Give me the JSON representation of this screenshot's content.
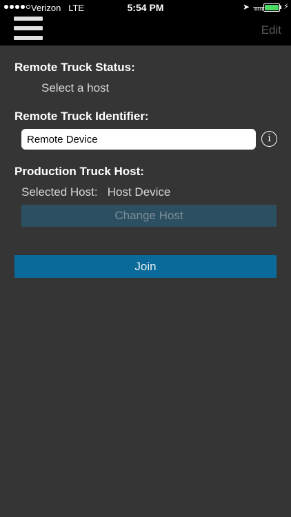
{
  "status_bar": {
    "carrier": "Verizon",
    "network": "LTE",
    "time": "5:54 PM"
  },
  "nav": {
    "menu_icon": "hamburger-menu-icon",
    "edit_label": "Edit"
  },
  "status_section": {
    "heading": "Remote Truck Status:",
    "value": "Select a host"
  },
  "identifier_section": {
    "heading": "Remote Truck Identifier:",
    "value": "Remote Device",
    "info_icon": "info-icon",
    "info_glyph": "i"
  },
  "host_section": {
    "heading": "Production Truck Host:",
    "selected_label": "Selected Host:",
    "selected_value": "Host Device",
    "change_button": "Change Host"
  },
  "join_button": "Join",
  "colors": {
    "background": "#353535",
    "topbar": "#000000",
    "join_button": "#0a6a99",
    "change_button_disabled": "#2c4f62"
  }
}
